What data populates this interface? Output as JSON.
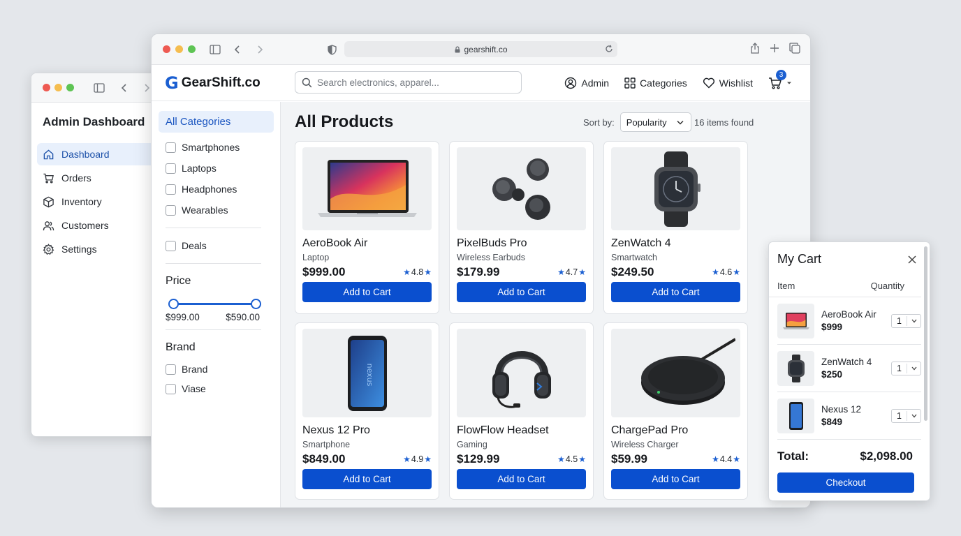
{
  "admin": {
    "title": "Admin Dashboard",
    "nav": [
      {
        "label": "Dashboard",
        "icon": "home-icon",
        "active": true
      },
      {
        "label": "Orders",
        "icon": "cart-icon"
      },
      {
        "label": "Inventory",
        "icon": "box-icon"
      },
      {
        "label": "Customers",
        "icon": "users-icon"
      },
      {
        "label": "Settings",
        "icon": "gear-icon"
      }
    ]
  },
  "browser": {
    "url": "gearshift.co"
  },
  "header": {
    "logo_mark": "G",
    "brand": "GearShift.co",
    "search_placeholder": "Search electronics, apparel...",
    "admin_label": "Admin",
    "categories_label": "Categories",
    "wishlist_label": "Wishlist",
    "cart_count": "3"
  },
  "filters": {
    "all_categories": "All Categories",
    "categories": [
      "Smartphones",
      "Laptops",
      "Headphones",
      "Wearables"
    ],
    "deals": "Deals",
    "price_title": "Price",
    "price_min": "$999.00",
    "price_max": "$590.00",
    "brand_title": "Brand",
    "brands": [
      "Brand",
      "Viase"
    ]
  },
  "products_section": {
    "title": "All Products",
    "sort_label": "Sort by:",
    "sort_value": "Popularity",
    "count": "16 items found"
  },
  "products": [
    {
      "name": "AeroBook Air",
      "sub": "Laptop",
      "price": "$999.00",
      "rating": "4.8",
      "button": "Add to Cart",
      "image": "laptop"
    },
    {
      "name": "PixelBuds Pro",
      "sub": "Wireless Earbuds",
      "price": "$179.99",
      "rating": "4.7",
      "button": "Add to Cart",
      "image": "earbuds"
    },
    {
      "name": "ZenWatch 4",
      "sub": "Smartwatch",
      "price": "$249.50",
      "rating": "4.6",
      "button": "Add to Cart",
      "image": "smartwatch"
    },
    {
      "name": "Nexus 12 Pro",
      "sub": "Smartphone",
      "price": "$849.00",
      "rating": "4.9",
      "button": "Add to Cart",
      "image": "smartphone"
    },
    {
      "name": "FlowFlow Headset",
      "sub": "Gaming",
      "price": "$129.99",
      "rating": "4.5",
      "button": "Add to Cart",
      "image": "headset"
    },
    {
      "name": "ChargePad Pro",
      "sub": "Wireless Charger",
      "price": "$59.99",
      "rating": "4.4",
      "button": "Add to Cart",
      "image": "charger"
    }
  ],
  "cart": {
    "title": "My Cart",
    "col_item": "Item",
    "col_qty": "Quantity",
    "items": [
      {
        "name": "AeroBook Air",
        "price": "$999",
        "qty": "1"
      },
      {
        "name": "ZenWatch 4",
        "price": "$250",
        "qty": "1"
      },
      {
        "name": "Nexus 12",
        "price": "$849",
        "qty": "1"
      }
    ],
    "total_label": "Total:",
    "total_value": "$2,098.00",
    "checkout": "Checkout"
  }
}
